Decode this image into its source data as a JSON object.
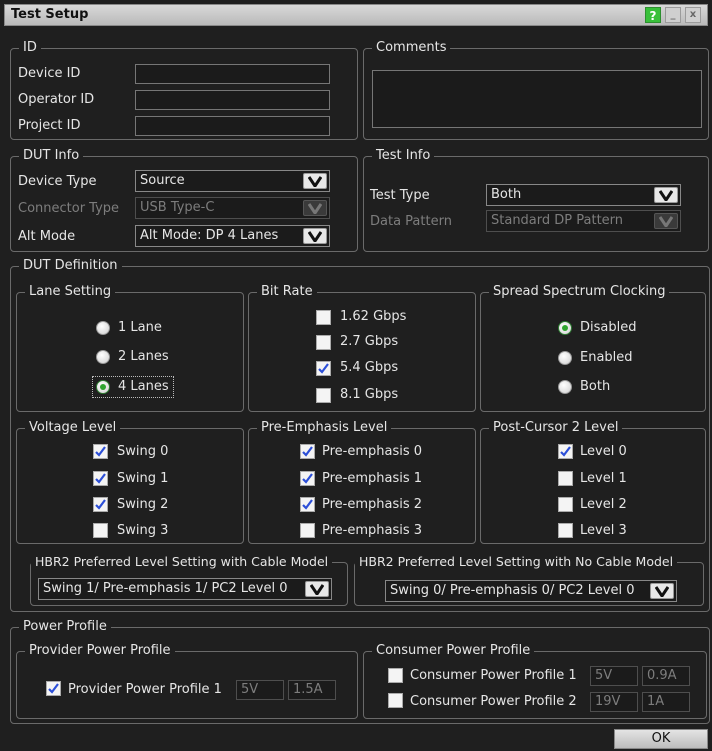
{
  "window": {
    "title": "Test Setup",
    "help_label": "?",
    "min_label": "_",
    "close_label": "x"
  },
  "id_section": {
    "legend": "ID",
    "device_id_label": "Device ID",
    "device_id_value": "",
    "operator_id_label": "Operator ID",
    "operator_id_value": "",
    "project_id_label": "Project ID",
    "project_id_value": ""
  },
  "comments": {
    "legend": "Comments",
    "value": ""
  },
  "dut_info": {
    "legend": "DUT Info",
    "device_type_label": "Device Type",
    "device_type_value": "Source",
    "connector_type_label": "Connector Type",
    "connector_type_value": "USB Type-C",
    "alt_mode_label": "Alt Mode",
    "alt_mode_value": "Alt Mode: DP 4 Lanes"
  },
  "test_info": {
    "legend": "Test Info",
    "test_type_label": "Test Type",
    "test_type_value": "Both",
    "data_pattern_label": "Data Pattern",
    "data_pattern_value": "Standard DP Pattern"
  },
  "dut_definition": {
    "legend": "DUT Definition"
  },
  "lane_setting": {
    "legend": "Lane Setting",
    "options": [
      {
        "label": "1 Lane",
        "selected": false
      },
      {
        "label": "2 Lanes",
        "selected": false
      },
      {
        "label": "4 Lanes",
        "selected": true
      }
    ]
  },
  "bit_rate": {
    "legend": "Bit Rate",
    "options": [
      {
        "label": "1.62 Gbps",
        "checked": false
      },
      {
        "label": "2.7 Gbps",
        "checked": false
      },
      {
        "label": "5.4 Gbps",
        "checked": true
      },
      {
        "label": "8.1 Gbps",
        "checked": false
      }
    ]
  },
  "ssc": {
    "legend": "Spread Spectrum Clocking",
    "options": [
      {
        "label": "Disabled",
        "selected": true
      },
      {
        "label": "Enabled",
        "selected": false
      },
      {
        "label": "Both",
        "selected": false
      }
    ]
  },
  "voltage_level": {
    "legend": "Voltage Level",
    "options": [
      {
        "label": "Swing 0",
        "checked": true
      },
      {
        "label": "Swing 1",
        "checked": true
      },
      {
        "label": "Swing 2",
        "checked": true
      },
      {
        "label": "Swing 3",
        "checked": false
      }
    ]
  },
  "pre_emphasis": {
    "legend": "Pre-Emphasis Level",
    "options": [
      {
        "label": "Pre-emphasis 0",
        "checked": true
      },
      {
        "label": "Pre-emphasis 1",
        "checked": true
      },
      {
        "label": "Pre-emphasis 2",
        "checked": true
      },
      {
        "label": "Pre-emphasis 3",
        "checked": false
      }
    ]
  },
  "post_cursor": {
    "legend": "Post-Cursor 2 Level",
    "options": [
      {
        "label": "Level 0",
        "checked": true
      },
      {
        "label": "Level 1",
        "checked": false
      },
      {
        "label": "Level 2",
        "checked": false
      },
      {
        "label": "Level 3",
        "checked": false
      }
    ]
  },
  "hbr2_cable": {
    "legend": "HBR2 Preferred Level Setting with Cable Model",
    "value": "Swing 1/ Pre-emphasis 1/ PC2 Level 0"
  },
  "hbr2_nocable": {
    "legend": "HBR2 Preferred Level Setting with No Cable Model",
    "value": "Swing 0/ Pre-emphasis 0/ PC2 Level 0"
  },
  "power_profile": {
    "legend": "Power Profile"
  },
  "provider_profile": {
    "legend": "Provider Power Profile",
    "item_label": "Provider Power Profile 1",
    "checked": true,
    "voltage": "5V",
    "current": "1.5A"
  },
  "consumer_profile": {
    "legend": "Consumer Power Profile",
    "items": [
      {
        "label": "Consumer Power Profile 1",
        "checked": false,
        "voltage": "5V",
        "current": "0.9A"
      },
      {
        "label": "Consumer Power Profile 2",
        "checked": false,
        "voltage": "19V",
        "current": "1A"
      }
    ]
  },
  "footer": {
    "ok_label": "OK"
  }
}
